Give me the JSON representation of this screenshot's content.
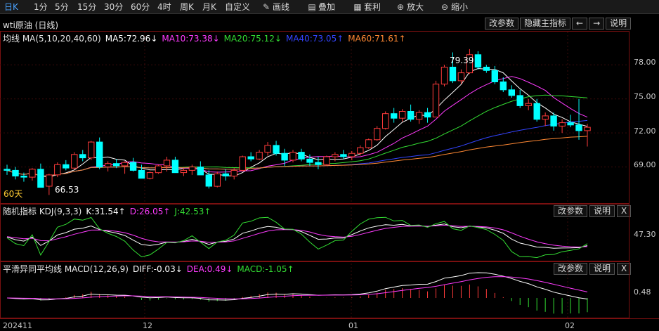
{
  "toolbar": {
    "items": [
      "日K",
      "1分",
      "5分",
      "15分",
      "30分",
      "60分",
      "4时",
      "周K",
      "月K",
      "自定义"
    ],
    "draw_label": "画线",
    "overlay_label": "叠加",
    "arbitrage_label": "套利",
    "zoom_in_label": "放大",
    "zoom_out_label": "缩小"
  },
  "main": {
    "title": "wti原油 (日线)",
    "buttons": {
      "params": "改参数",
      "hide_indicator": "隐藏主指标",
      "prev": "←",
      "next": "→",
      "help": "说明"
    },
    "legend": {
      "name": "均线 MA(5,10,20,40,60)",
      "ma5": "MA5:72.96↓",
      "ma10": "MA10:73.38↓",
      "ma20": "MA20:75.12↓",
      "ma40": "MA40:73.05↑",
      "ma60": "MA60:71.61↑"
    },
    "annotations": {
      "high": "79.39",
      "low": "66.53",
      "period": "60天"
    },
    "y_ticks": [
      "78.00",
      "75.00",
      "72.00",
      "69.00"
    ]
  },
  "kdj": {
    "legend": {
      "name": "随机指标 KDJ(9,3,3)",
      "k": "K:31.54↑",
      "d": "D:26.05↑",
      "j": "J:42.53↑"
    },
    "buttons": {
      "params": "改参数",
      "help": "说明",
      "close": "X"
    },
    "y_tick": "47.30"
  },
  "macd": {
    "legend": {
      "name": "平滑异同平均线 MACD(12,26,9)",
      "diff": "DIFF:-0.03↓",
      "dea": "DEA:0.49↓",
      "macd": "MACD:-1.05↑"
    },
    "buttons": {
      "params": "改参数",
      "help": "说明",
      "close": "X"
    },
    "y_tick": "0.48"
  },
  "x_axis": [
    "202411",
    "12",
    "01",
    "02"
  ],
  "colors": {
    "up": "#ff3b3b",
    "down": "#00ffff",
    "ma5": "#ffffff",
    "ma10": "#ff3bff",
    "ma20": "#33dd33",
    "ma40": "#3344ff",
    "ma60": "#ff8833",
    "active": "#4aa3ff"
  },
  "chart_data": {
    "type": "candlestick",
    "y_range": [
      66.0,
      80.0
    ],
    "candles": [
      [
        68.8,
        69.2,
        68.3,
        68.7
      ],
      [
        68.7,
        69.0,
        67.9,
        68.2
      ],
      [
        68.2,
        68.5,
        67.7,
        68.1
      ],
      [
        68.1,
        68.9,
        67.8,
        68.8
      ],
      [
        68.8,
        69.3,
        68.3,
        67.2
      ],
      [
        67.3,
        68.4,
        66.53,
        68.3
      ],
      [
        68.3,
        69.4,
        68.1,
        69.2
      ],
      [
        69.2,
        69.6,
        68.7,
        68.9
      ],
      [
        68.9,
        70.3,
        68.8,
        70.1
      ],
      [
        70.1,
        70.5,
        69.5,
        69.8
      ],
      [
        69.8,
        71.3,
        69.6,
        71.2
      ],
      [
        71.2,
        71.6,
        68.8,
        69.0
      ],
      [
        69.0,
        69.5,
        68.6,
        69.3
      ],
      [
        69.3,
        69.7,
        68.9,
        69.1
      ],
      [
        69.1,
        69.5,
        68.4,
        69.4
      ],
      [
        69.4,
        69.8,
        68.6,
        68.7
      ],
      [
        68.7,
        69.2,
        68.1,
        68.0
      ],
      [
        68.0,
        68.6,
        67.9,
        68.5
      ],
      [
        68.5,
        69.2,
        68.4,
        69.1
      ],
      [
        69.1,
        69.9,
        68.6,
        69.6
      ],
      [
        69.6,
        69.9,
        68.6,
        68.5
      ],
      [
        68.5,
        68.9,
        68.2,
        68.7
      ],
      [
        68.7,
        69.2,
        68.3,
        69.0
      ],
      [
        69.0,
        69.5,
        68.4,
        68.3
      ],
      [
        68.3,
        68.7,
        67.1,
        67.3
      ],
      [
        67.3,
        68.6,
        67.2,
        68.4
      ],
      [
        68.4,
        68.8,
        67.8,
        68.2
      ],
      [
        68.2,
        68.9,
        67.9,
        68.7
      ],
      [
        68.7,
        70.0,
        68.6,
        69.9
      ],
      [
        69.9,
        70.3,
        69.5,
        69.7
      ],
      [
        69.7,
        70.5,
        69.6,
        70.3
      ],
      [
        70.3,
        71.2,
        70.0,
        70.9
      ],
      [
        70.9,
        71.3,
        70.0,
        70.2
      ],
      [
        70.2,
        70.6,
        69.1,
        69.6
      ],
      [
        69.6,
        70.5,
        69.4,
        70.3
      ],
      [
        70.3,
        70.6,
        69.5,
        69.7
      ],
      [
        69.7,
        70.1,
        69.1,
        69.4
      ],
      [
        69.4,
        69.9,
        68.8,
        69.2
      ],
      [
        69.2,
        70.0,
        69.1,
        69.9
      ],
      [
        69.9,
        70.3,
        69.5,
        70.1
      ],
      [
        70.1,
        70.5,
        69.7,
        69.9
      ],
      [
        69.9,
        70.4,
        69.6,
        70.2
      ],
      [
        70.2,
        70.9,
        70.0,
        70.7
      ],
      [
        70.7,
        71.5,
        70.6,
        71.4
      ],
      [
        71.4,
        72.6,
        71.3,
        72.4
      ],
      [
        72.4,
        73.9,
        72.3,
        73.7
      ],
      [
        73.7,
        74.2,
        72.9,
        73.3
      ],
      [
        73.3,
        74.1,
        73.0,
        73.9
      ],
      [
        73.9,
        74.5,
        73.0,
        73.2
      ],
      [
        73.2,
        74.0,
        72.8,
        73.8
      ],
      [
        73.8,
        74.2,
        72.9,
        73.4
      ],
      [
        73.4,
        76.6,
        73.4,
        76.3
      ],
      [
        76.3,
        78.0,
        76.1,
        77.8
      ],
      [
        77.8,
        79.1,
        76.4,
        76.6
      ],
      [
        76.6,
        77.6,
        76.3,
        77.3
      ],
      [
        77.3,
        79.39,
        77.2,
        78.9
      ],
      [
        78.9,
        79.2,
        77.6,
        77.8
      ],
      [
        77.8,
        78.0,
        77.3,
        77.5
      ],
      [
        77.5,
        77.9,
        76.3,
        76.5
      ],
      [
        76.5,
        76.9,
        75.6,
        75.8
      ],
      [
        75.8,
        76.2,
        75.1,
        75.3
      ],
      [
        75.3,
        75.8,
        74.2,
        74.4
      ],
      [
        74.4,
        75.0,
        74.0,
        74.6
      ],
      [
        74.6,
        75.0,
        73.0,
        73.2
      ],
      [
        73.2,
        73.8,
        72.6,
        73.5
      ],
      [
        73.5,
        73.8,
        72.2,
        72.6
      ],
      [
        72.6,
        73.2,
        72.0,
        72.9
      ],
      [
        72.9,
        73.6,
        72.5,
        72.7
      ],
      [
        72.7,
        75.0,
        71.4,
        72.2
      ],
      [
        72.2,
        72.8,
        70.8,
        72.5
      ]
    ]
  }
}
